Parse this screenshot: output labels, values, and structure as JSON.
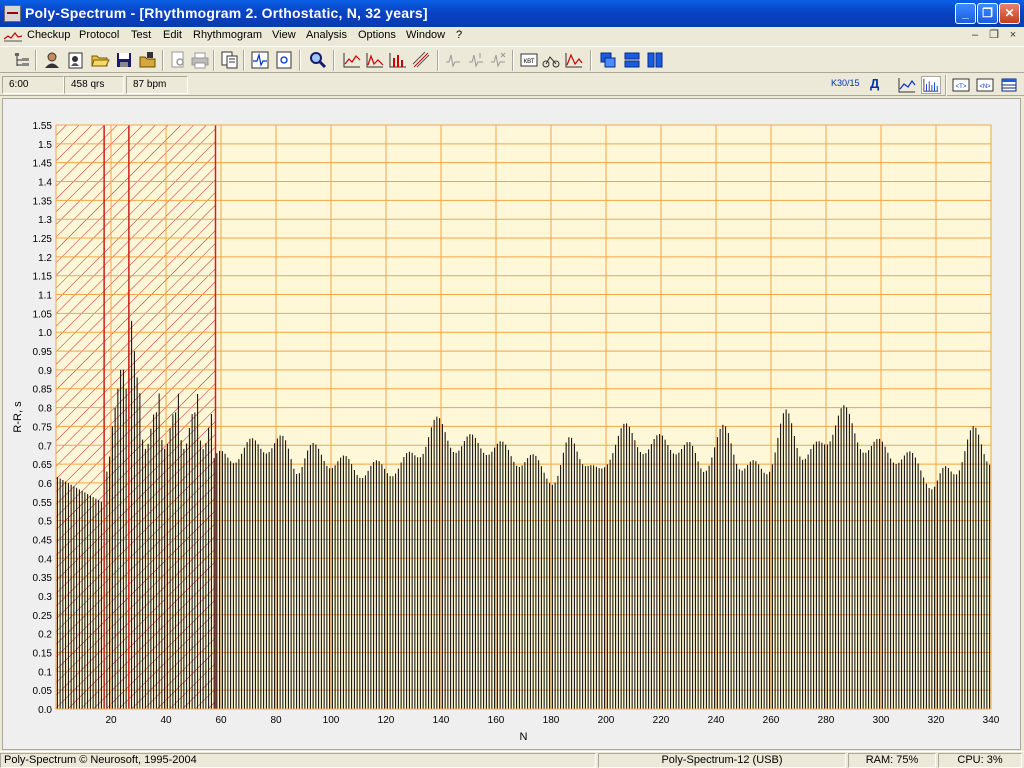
{
  "window": {
    "title": "Poly-Spectrum - [Rhythmogram 2. Orthostatic, N, 32 years]",
    "minimize_glyph": "_",
    "maximize_glyph": "❐",
    "close_glyph": "✕"
  },
  "menu": {
    "items": [
      "Checkup",
      "Protocol",
      "Test",
      "Edit",
      "Rhythmogram",
      "View",
      "Analysis",
      "Options",
      "Window",
      "?"
    ],
    "mdi_minimize": "–",
    "mdi_restore": "❐",
    "mdi_close": "×"
  },
  "toolbar": {
    "icons": [
      "tree-icon",
      "patient-icon",
      "new-patient-icon",
      "open-folder-icon",
      "save-icon",
      "export-icon",
      "print-preview-icon",
      "print-icon",
      "copy-report-icon",
      "ecg-view-icon",
      "report-icon",
      "zoom-icon",
      "rhythmogram-icon",
      "histogram-icon",
      "bar-chart-icon",
      "scatter-icon",
      "marker-icon",
      "marker-edit-icon",
      "marker-delete-icon",
      "kbt-icon",
      "bike-icon",
      "spectrum-icon",
      "cascade-icon",
      "tile-horizontal-icon",
      "tile-vertical-icon"
    ]
  },
  "info": {
    "time": "6:00",
    "qrs": "458 qrs",
    "bpm": "87 bpm",
    "filter_label": "K30/15",
    "filter_letter": "Д"
  },
  "status": {
    "copyright": "Poly-Spectrum © Neurosoft, 1995-2004",
    "device": "Poly-Spectrum-12 (USB)",
    "ram": "RAM: 75%",
    "cpu": "CPU: 3%"
  },
  "colors": {
    "plot_background": "#fff8d8",
    "grid": "#f5a545",
    "hatch": "#cc1f1f",
    "bars": "#000000"
  },
  "chart_data": {
    "type": "bar",
    "xlabel": "N",
    "ylabel": "R-R, s",
    "xlim": [
      0,
      340
    ],
    "ylim": [
      0,
      1.55
    ],
    "y_ticks": [
      "0.0",
      "0.05",
      "0.1",
      "0.15",
      "0.2",
      "0.25",
      "0.3",
      "0.35",
      "0.4",
      "0.45",
      "0.5",
      "0.55",
      "0.6",
      "0.65",
      "0.7",
      "0.75",
      "0.8",
      "0.85",
      "0.9",
      "0.95",
      "1.0",
      "1.05",
      "1.1",
      "1.15",
      "1.2",
      "1.25",
      "1.3",
      "1.35",
      "1.4",
      "1.45",
      "1.5",
      "1.55"
    ],
    "x_ticks": [
      "20",
      "40",
      "60",
      "80",
      "100",
      "120",
      "140",
      "160",
      "180",
      "200",
      "220",
      "240",
      "260",
      "280",
      "300",
      "320",
      "340"
    ],
    "excluded_region": {
      "x_start": 0,
      "x_end": 58
    },
    "grid": true,
    "bar_count": 340
  }
}
